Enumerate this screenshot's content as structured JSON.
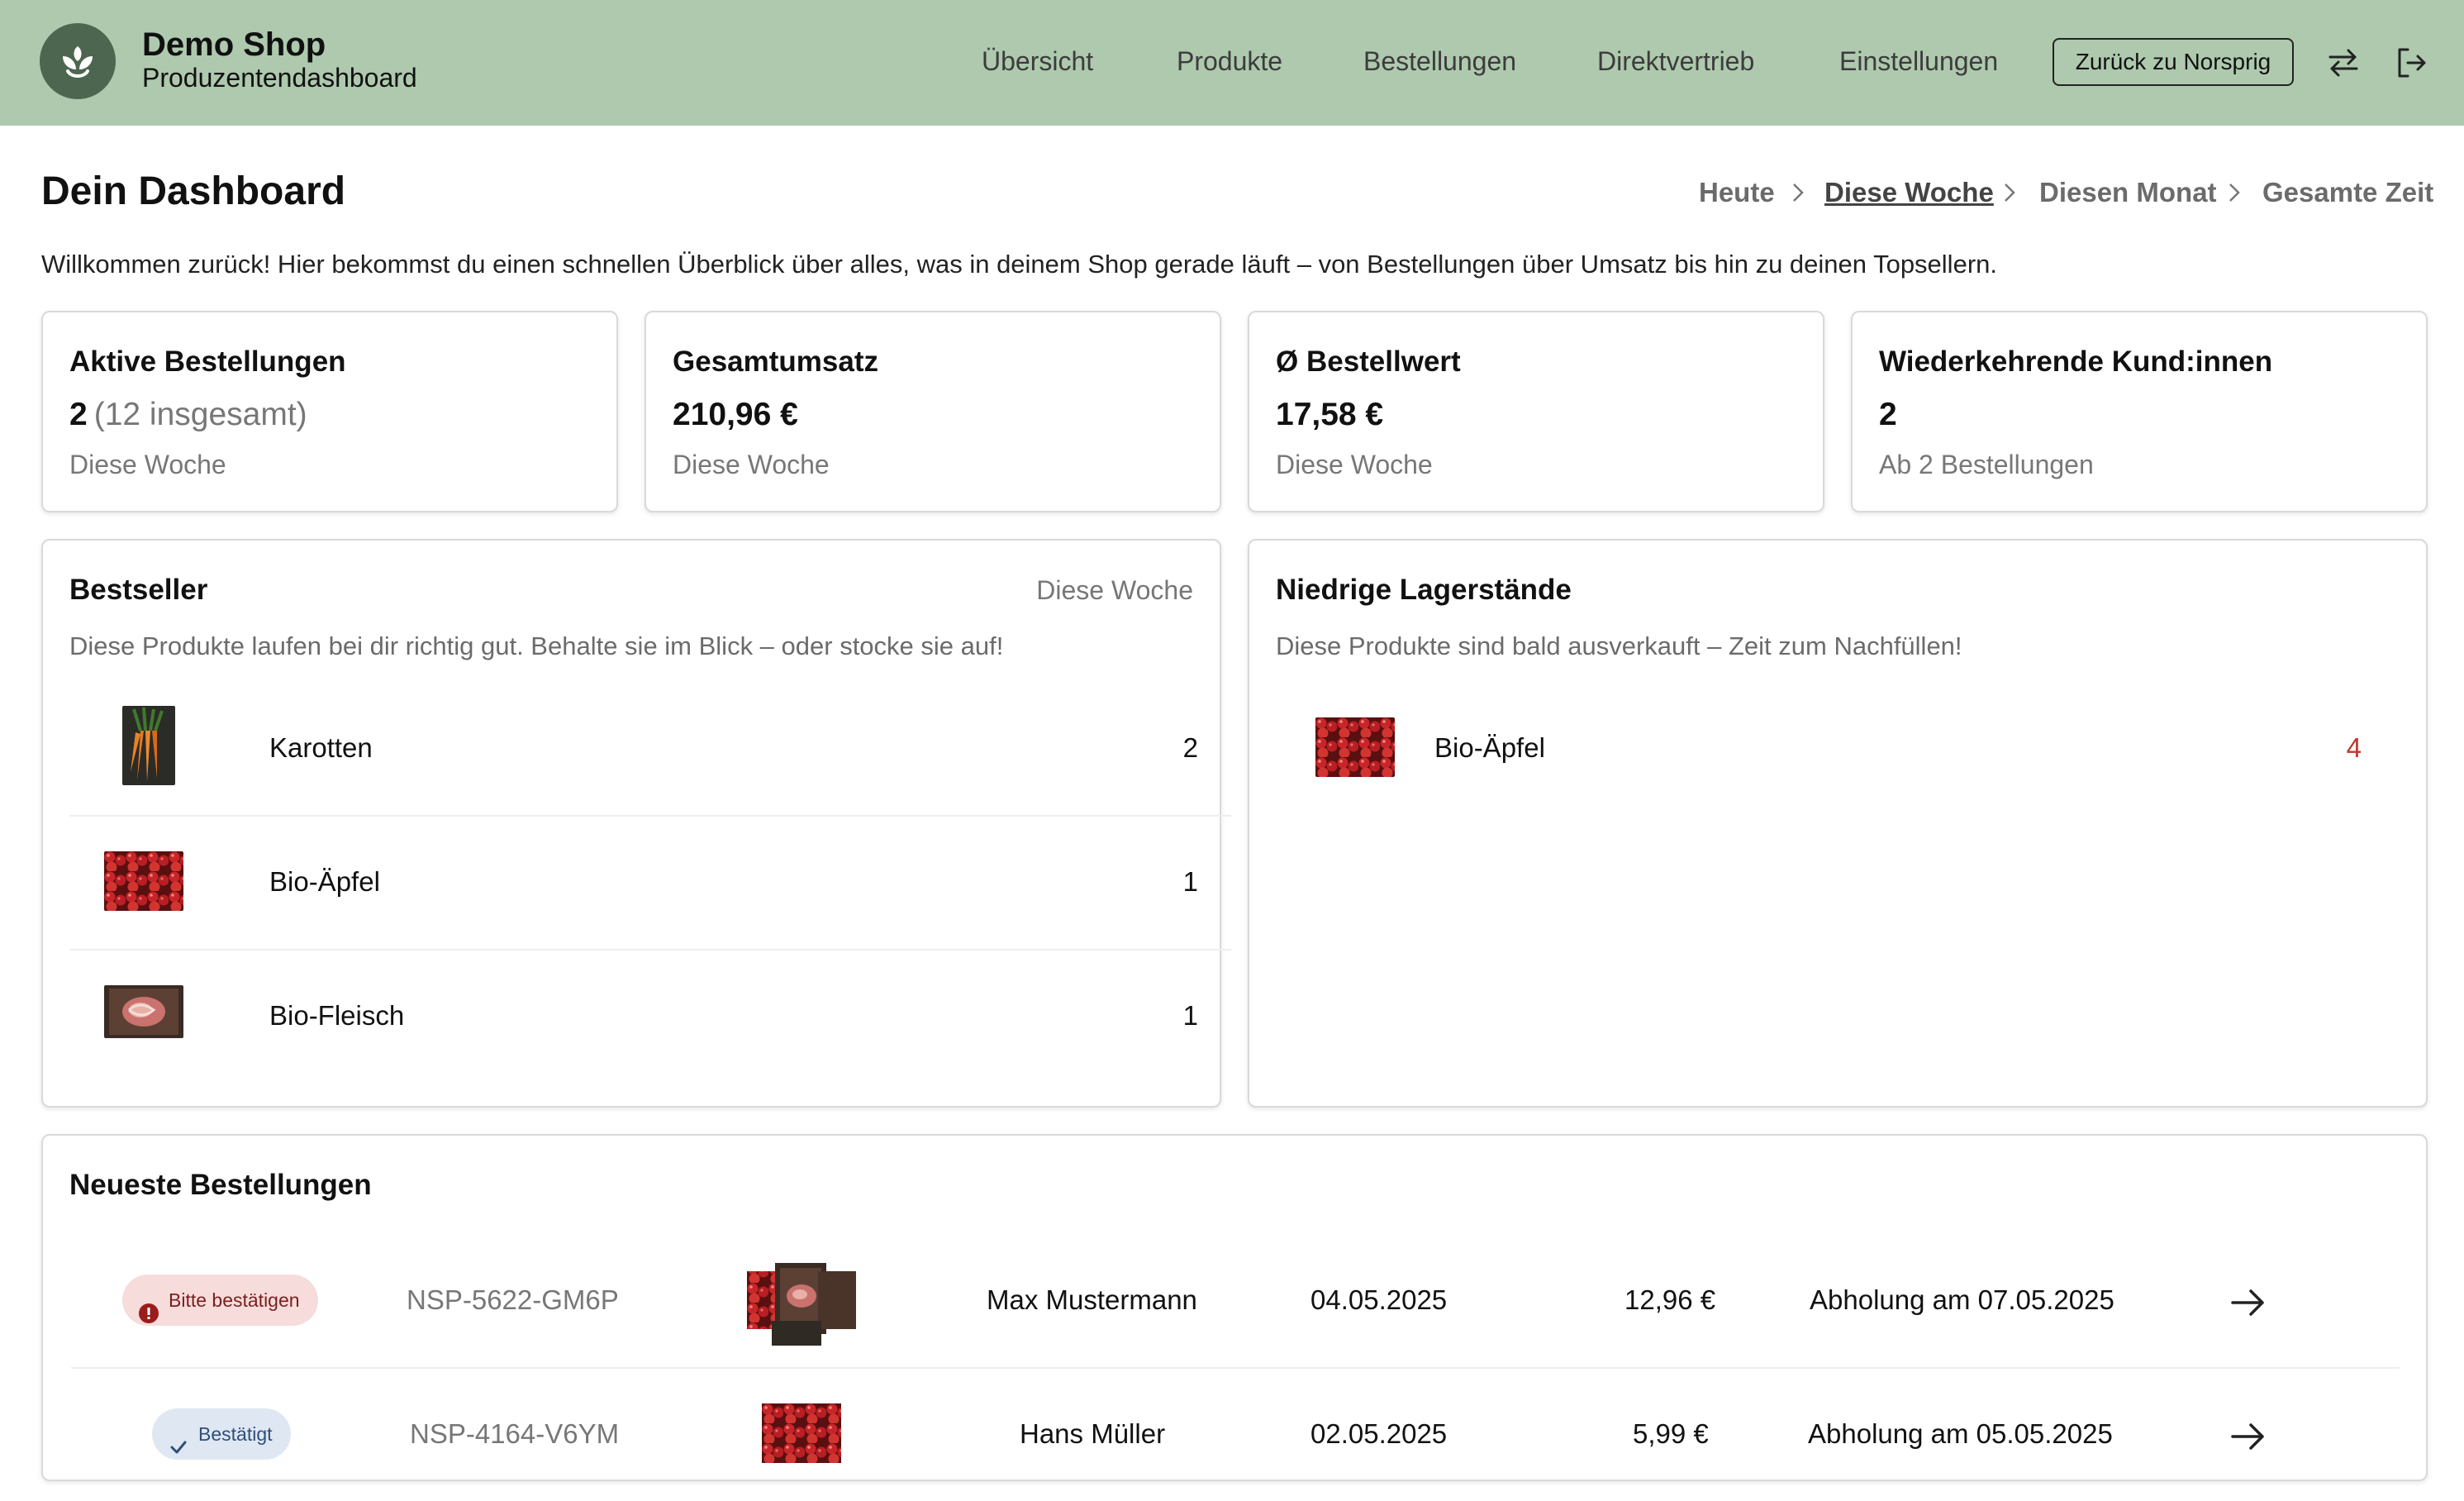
{
  "header": {
    "shop_name": "Demo Shop",
    "subtitle": "Produzentendashboard",
    "nav": [
      "Übersicht",
      "Produkte",
      "Bestellungen",
      "Direktvertrieb",
      "Einstellungen"
    ],
    "back_button": "Zurück zu Norsprig"
  },
  "dashboard": {
    "title": "Dein Dashboard",
    "periods": [
      "Heute",
      "Diese Woche",
      "Diesen Monat",
      "Gesamte Zeit"
    ],
    "active_period": "Diese Woche",
    "intro": "Willkommen zurück! Hier bekommst du einen schnellen Überblick über alles, was in deinem Shop gerade läuft – von Bestellungen über Umsatz bis hin zu deinen Topsellern."
  },
  "stats": [
    {
      "title": "Aktive Bestellungen",
      "value": "2",
      "extra": "(12 insgesamt)",
      "sub": "Diese Woche"
    },
    {
      "title": "Gesamtumsatz",
      "value": "210,96 €",
      "sub": "Diese Woche"
    },
    {
      "title": "Ø Bestellwert",
      "value": "17,58 €",
      "sub": "Diese Woche"
    },
    {
      "title": "Wiederkehrende Kund:innen",
      "value": "2",
      "sub": "Ab 2 Bestellungen"
    }
  ],
  "bestseller": {
    "title": "Bestseller",
    "period": "Diese Woche",
    "description": "Diese Produkte laufen bei dir richtig gut. Behalte sie im Blick – oder stocke sie auf!",
    "items": [
      {
        "name": "Karotten",
        "count": "2",
        "image": "carrots"
      },
      {
        "name": "Bio-Äpfel",
        "count": "1",
        "image": "apples"
      },
      {
        "name": "Bio-Fleisch",
        "count": "1",
        "image": "meat"
      }
    ]
  },
  "low_stock": {
    "title": "Niedrige Lagerstände",
    "description": "Diese Produkte sind bald ausverkauft – Zeit zum Nachfüllen!",
    "items": [
      {
        "name": "Bio-Äpfel",
        "count": "4",
        "image": "apples"
      }
    ]
  },
  "orders": {
    "title": "Neueste Bestellungen",
    "rows": [
      {
        "status": "Bitte bestätigen",
        "status_type": "pending",
        "id": "NSP-5622-GM6P",
        "customer": "Max Mustermann",
        "date": "04.05.2025",
        "amount": "12,96 €",
        "pickup": "Abholung am 07.05.2025"
      },
      {
        "status": "Bestätigt",
        "status_type": "confirmed",
        "id": "NSP-4164-V6YM",
        "customer": "Hans Müller",
        "date": "02.05.2025",
        "amount": "5,99 €",
        "pickup": "Abholung am 05.05.2025"
      }
    ]
  },
  "colors": {
    "header_bg": "#aec9ae",
    "logo_bg": "#4d6650",
    "low_stock_count": "#c0392b",
    "pending_badge": "#f7dcdc",
    "confirmed_badge": "#dfe7f3"
  },
  "icons": [
    "sprout-logo-icon",
    "switch-arrows-icon",
    "logout-icon",
    "chevron-right-icon",
    "alert-icon",
    "check-icon",
    "arrow-right-icon"
  ]
}
